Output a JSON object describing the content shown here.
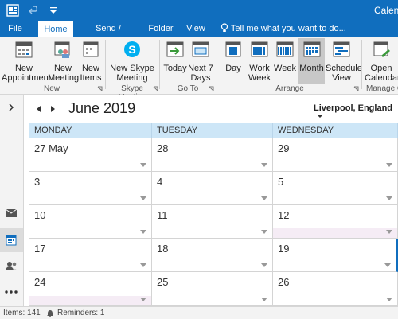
{
  "window": {
    "title": "Calen"
  },
  "tabs": [
    {
      "label": "File"
    },
    {
      "label": "Home"
    },
    {
      "label": "Send / Receive"
    },
    {
      "label": "Folder"
    },
    {
      "label": "View"
    }
  ],
  "tell_me": "Tell me what you want to do...",
  "ribbon": {
    "new": {
      "appointment": "New\nAppointment",
      "meeting": "New\nMeeting",
      "items": "New\nItems"
    },
    "new_group": "New",
    "skype": {
      "meeting": "New Skype\nMeeting",
      "group": "Skype Meeting"
    },
    "goto": {
      "today": "Today",
      "next7": "Next 7\nDays",
      "group": "Go To"
    },
    "arrange": {
      "day": "Day",
      "work_week": "Work\nWeek",
      "week": "Week",
      "month": "Month",
      "schedule": "Schedule\nView",
      "group": "Arrange"
    },
    "manage": {
      "open": "Open\nCalendar",
      "group": "Manage C"
    }
  },
  "calendar": {
    "month_title": "June 2019",
    "location": "Liverpool, England",
    "day_headers": [
      "MONDAY",
      "TUESDAY",
      "WEDNESDAY"
    ],
    "weeks": [
      [
        "27 May",
        "28",
        "29"
      ],
      [
        "3",
        "4",
        "5"
      ],
      [
        "10",
        "11",
        "12"
      ],
      [
        "17",
        "18",
        "19"
      ],
      [
        "24",
        "25",
        "26"
      ]
    ]
  },
  "status": {
    "items": "Items: 141",
    "reminders": "Reminders: 1"
  },
  "colors": {
    "accent": "#106ebe",
    "day_header_bg": "#cde6f7",
    "selected_button": "#c8c8c8"
  }
}
